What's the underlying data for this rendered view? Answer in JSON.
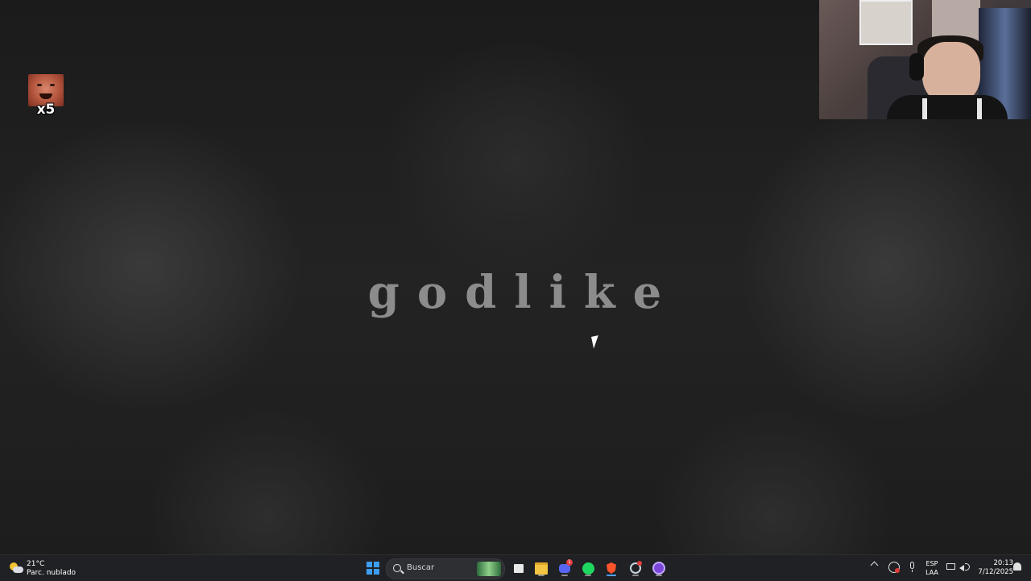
{
  "wallpaper": {
    "title": "godlike"
  },
  "stream_overlay": {
    "alert_count": "x5"
  },
  "taskbar": {
    "weather": {
      "temperature": "21°C",
      "description": "Parc. nublado",
      "icon": "partly-cloudy-icon"
    },
    "search": {
      "placeholder": "Buscar"
    },
    "pinned_apps": [
      {
        "name": "Windows Start",
        "icon": "windows-logo-icon"
      },
      {
        "name": "Task View",
        "icon": "task-view-icon"
      },
      {
        "name": "File Explorer",
        "icon": "folder-icon"
      },
      {
        "name": "Discord",
        "icon": "discord-icon",
        "badge": "1"
      },
      {
        "name": "Spotify",
        "icon": "spotify-icon"
      },
      {
        "name": "Brave",
        "icon": "brave-icon"
      },
      {
        "name": "Steam",
        "icon": "steam-icon"
      },
      {
        "name": "OBS",
        "icon": "obs-icon"
      }
    ],
    "tray": {
      "language": "ESP",
      "layout": "LAA",
      "time": "20:13",
      "date": "7/12/2025"
    }
  },
  "colors": {
    "taskbar_bg": "#202124",
    "accent": "#4fa3f7",
    "title_text": "#8c8c8c"
  }
}
